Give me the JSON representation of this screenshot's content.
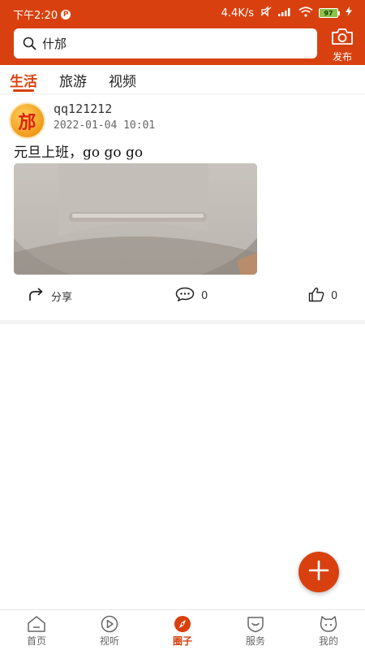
{
  "status_bar": {
    "time": "下午2:20",
    "badge": "P",
    "network_speed": "4.4K/s",
    "battery": "97"
  },
  "header": {
    "search_text": "什邡",
    "publish_label": "发布"
  },
  "tabs": [
    {
      "label": "生活",
      "active": true
    },
    {
      "label": "旅游",
      "active": false
    },
    {
      "label": "视频",
      "active": false
    }
  ],
  "post": {
    "avatar_text": "邡",
    "username": "qq121212",
    "datetime": "2022-01-04 10:01",
    "text": "元旦上班，go go go",
    "share_label": "分享",
    "comment_count": "0",
    "like_count": "0"
  },
  "bottom_nav": [
    {
      "label": "首页",
      "icon": "home-icon",
      "active": false
    },
    {
      "label": "视听",
      "icon": "play-icon",
      "active": false
    },
    {
      "label": "圈子",
      "icon": "compass-icon",
      "active": true
    },
    {
      "label": "服务",
      "icon": "service-icon",
      "active": false
    },
    {
      "label": "我的",
      "icon": "profile-icon",
      "active": false
    }
  ],
  "colors": {
    "brand": "#d8410f",
    "battery": "#8bc34a"
  }
}
